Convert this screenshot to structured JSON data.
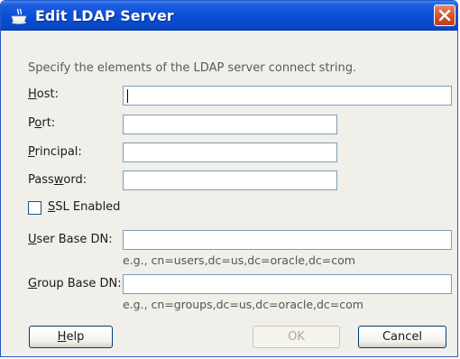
{
  "window": {
    "title": "Edit LDAP Server"
  },
  "description": "Specify the elements of the LDAP server connect string.",
  "fields": {
    "host": {
      "label_pre": "",
      "label_u": "H",
      "label_post": "ost:",
      "value": ""
    },
    "port": {
      "label_pre": "P",
      "label_u": "o",
      "label_post": "rt:",
      "value": ""
    },
    "principal": {
      "label_pre": "",
      "label_u": "P",
      "label_post": "rincipal:",
      "value": ""
    },
    "password": {
      "label_pre": "Pass",
      "label_u": "w",
      "label_post": "ord:",
      "value": ""
    },
    "user_base_dn": {
      "label_pre": "",
      "label_u": "U",
      "label_post": "ser Base DN:",
      "value": "",
      "hint": "e.g., cn=users,dc=us,dc=oracle,dc=com"
    },
    "group_base_dn": {
      "label_pre": "",
      "label_u": "G",
      "label_post": "roup Base DN:",
      "value": "",
      "hint": "e.g., cn=groups,dc=us,dc=oracle,dc=com"
    }
  },
  "ssl": {
    "label_pre": "",
    "label_u": "S",
    "label_post": "SL Enabled",
    "checked": false
  },
  "buttons": {
    "help": {
      "label_u": "H",
      "label_post": "elp"
    },
    "ok": {
      "label": "OK",
      "enabled": false
    },
    "cancel": {
      "label": "Cancel"
    }
  },
  "colors": {
    "titlebar": "#0a4fd6",
    "close": "#c13e18",
    "dialog_bg": "#f0efea",
    "field_border": "#7f9db9"
  },
  "icons": {
    "title": "cup-icon",
    "close": "close-icon"
  }
}
